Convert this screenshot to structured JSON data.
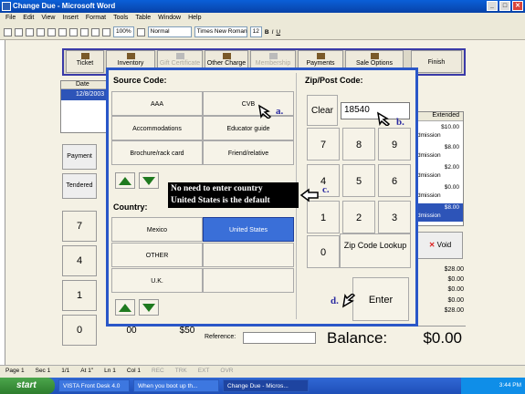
{
  "window": {
    "title": "Change Due - Microsoft Word"
  },
  "menu": [
    "File",
    "Edit",
    "View",
    "Insert",
    "Format",
    "Tools",
    "Table",
    "Window",
    "Help"
  ],
  "toolbar": {
    "zoom": "100%",
    "style": "Normal",
    "font": "Times New Roman",
    "size": "12",
    "bold": "B",
    "italic": "I",
    "underline": "U"
  },
  "pos_toolbar": {
    "ticket": "Ticket",
    "inventory": "Inventory",
    "gift_certificate": "Gift Certificate",
    "other_charge": "Other Charge",
    "membership": "Membership",
    "payments": "Payments",
    "sale_options": "Sale Options",
    "finish": "Finish"
  },
  "ticket_list": {
    "header": "Date",
    "row_date": "12/8/2003"
  },
  "left_buttons": {
    "payment": "Payment",
    "tendered": "Tendered"
  },
  "left_keypad": [
    "7",
    "4",
    "1",
    "0"
  ],
  "bottom_keys": {
    "double_zero": "00",
    "fifty": "$50"
  },
  "reference_label": "Reference:",
  "extended": {
    "header": "Extended",
    "rows": [
      {
        "amount": "$10.00",
        "label": "dmission"
      },
      {
        "amount": "$8.00",
        "label": "dmission"
      },
      {
        "amount": "$2.00",
        "label": "dmission"
      },
      {
        "amount": "$0.00",
        "label": "dmission"
      },
      {
        "amount": "$8.00",
        "label": "dmission"
      }
    ]
  },
  "void_label": "Void",
  "totals": [
    "$28.00",
    "$0.00",
    "$0.00",
    "$0.00",
    "$28.00"
  ],
  "balance": {
    "label": "Balance:",
    "value": "$0.00"
  },
  "dialog": {
    "source_code_label": "Source Code:",
    "source_codes": [
      "AAA",
      "CVB",
      "Accommodations",
      "Educator guide",
      "Brochure/rack card",
      "Friend/relative"
    ],
    "country_label": "Country:",
    "countries": [
      "Mexico",
      "United States",
      "OTHER",
      "",
      "U.K.",
      ""
    ],
    "selected_country": "United States",
    "zip_label": "Zip/Post Code:",
    "zip_value": "18540",
    "clear": "Clear",
    "keypad": [
      "7",
      "8",
      "9",
      "4",
      "5",
      "6",
      "1",
      "2",
      "3",
      "0"
    ],
    "zip_lookup": "Zip Code Lookup",
    "enter": "Enter"
  },
  "annotations": {
    "a": "a.",
    "b": "b.",
    "c": "c.",
    "d": "d.",
    "callout_line1": "No need to enter country",
    "callout_line2": "United States is the default"
  },
  "statusbar": [
    "Page 1",
    "Sec 1",
    "1/1",
    "At 1\"",
    "Ln 1",
    "Col 1",
    "REC",
    "TRK",
    "EXT",
    "OVR"
  ],
  "taskbar": {
    "start": "start",
    "tasks": [
      "VISTA Front Desk 4.0",
      "When you boot up th...",
      "Change Due - Micros..."
    ],
    "clock": "3:44 PM"
  }
}
